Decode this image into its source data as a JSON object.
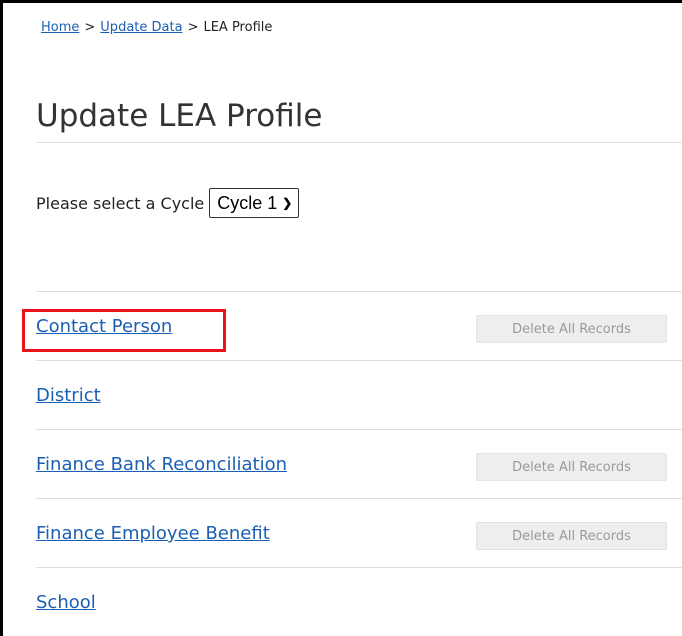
{
  "breadcrumb": {
    "home": "Home",
    "update_data": "Update Data",
    "current": "LEA Profile",
    "separator": ">"
  },
  "page": {
    "title": "Update LEA Profile"
  },
  "cycle": {
    "prompt": "Please select a Cycle",
    "selected": "Cycle 1"
  },
  "items": [
    {
      "label": "Contact Person",
      "delete_label": "Delete All Records",
      "highlighted": true
    },
    {
      "label": "District"
    },
    {
      "label": "Finance Bank Reconciliation",
      "delete_label": "Delete All Records"
    },
    {
      "label": "Finance Employee Benefit",
      "delete_label": "Delete All Records"
    },
    {
      "label": "School"
    }
  ],
  "colors": {
    "link": "#1a5fb4",
    "highlight": "#e8141b",
    "disabled_button_bg": "#eeeeee",
    "disabled_button_text": "#9a9a9a"
  },
  "icons": {
    "select_chevron": "chevron-down-icon"
  }
}
